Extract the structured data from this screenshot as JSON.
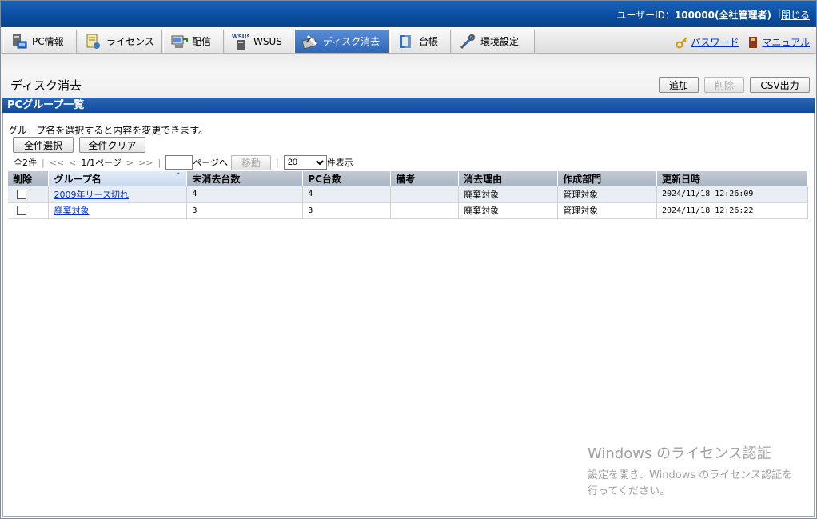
{
  "header": {
    "user_label": "ユーザーID：",
    "user_value": "100000(全社管理者)",
    "close_label": "閉じる"
  },
  "nav": {
    "tabs": [
      {
        "label": "PC情報",
        "icon": "pc-icon"
      },
      {
        "label": "ライセンス",
        "icon": "license-icon"
      },
      {
        "label": "配信",
        "icon": "distribution-icon"
      },
      {
        "label": "WSUS",
        "icon": "wsus-icon"
      },
      {
        "label": "ディスク消去",
        "icon": "disk-erase-icon",
        "active": true
      },
      {
        "label": "台帳",
        "icon": "ledger-icon"
      },
      {
        "label": "環境設定",
        "icon": "settings-icon"
      }
    ],
    "password_label": "パスワード",
    "manual_label": "マニュアル"
  },
  "page": {
    "title": "ディスク消去",
    "add_label": "追加",
    "delete_label": "削除",
    "csv_label": "CSV出力"
  },
  "section": {
    "title": "PCグループ一覧",
    "hint": "グループ名を選択すると内容を変更できます。",
    "select_all_label": "全件選択",
    "clear_all_label": "全件クリア"
  },
  "pager": {
    "total": "全2件",
    "first": "<<",
    "prev": "<",
    "page_info": "1/1ページ",
    "next": ">",
    "last": ">>",
    "goto_suffix": "ページへ",
    "move_label": "移動",
    "per_page_value": "20",
    "per_page_suffix": "件表示"
  },
  "table": {
    "columns": [
      "削除",
      "グループ名",
      "未消去台数",
      "PC台数",
      "備考",
      "消去理由",
      "作成部門",
      "更新日時"
    ],
    "rows": [
      {
        "group": "2009年リース切れ",
        "unerased": "4",
        "pc_count": "4",
        "note": "",
        "reason": "廃棄対象",
        "dept": "管理対象",
        "updated": "2024/11/18 12:26:09"
      },
      {
        "group": "廃棄対象",
        "unerased": "3",
        "pc_count": "3",
        "note": "",
        "reason": "廃棄対象",
        "dept": "管理対象",
        "updated": "2024/11/18 12:26:22"
      }
    ]
  },
  "watermark": {
    "line1": "Windows のライセンス認証",
    "line2": "設定を開き、Windows のライセンス認証を",
    "line3": "行ってください。"
  },
  "colors": {
    "header_blue": "#0a4c9e",
    "active_tab": "#2e66b8",
    "link": "#0033cc",
    "table_header": "#b4bfcc"
  }
}
